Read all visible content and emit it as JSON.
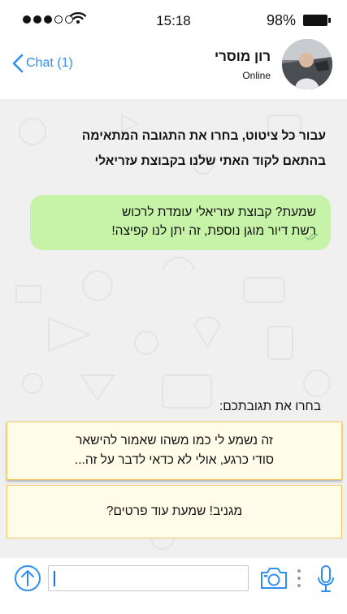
{
  "status_bar": {
    "time": "15:18",
    "battery_percent": "98%",
    "signal_strength": 3,
    "signal_max": 5
  },
  "header": {
    "back_label": "Chat (1)",
    "contact_name": "רון מוסרי",
    "contact_status": "Online"
  },
  "chat": {
    "prompt_line1": "עבור כל ציטוט, בחרו את התגובה המתאימה",
    "prompt_line2": "בהתאם לקוד האתי שלנו בקבוצת עזריאלי",
    "message_line1": "שמעת? קבוצת עזריאלי עומדת לרכוש",
    "message_line2": "רשת דיור מוגן נוספת, זה יתן לנו קפיצה!",
    "choose_label": "בחרו את תגובתכם:",
    "options": [
      {
        "line1": "זה נשמע לי כמו משהו שאמור להישאר",
        "line2": "סודי כרגע, אולי לא כדאי לדבר על זה..."
      },
      {
        "line1": "מגניב! שמעת עוד פרטים?",
        "line2": ""
      }
    ]
  },
  "input": {
    "value": "",
    "placeholder": ""
  },
  "colors": {
    "accent": "#2f8ff0",
    "bubble": "#c6f3a8",
    "option_bg": "#fffce9",
    "option_border": "#efc95e",
    "chat_bg": "#f0f0f0"
  },
  "icons": [
    "wifi-icon",
    "chevron-left-icon",
    "upload-icon",
    "camera-icon",
    "more-vertical-icon",
    "microphone-icon",
    "double-check-icon"
  ]
}
